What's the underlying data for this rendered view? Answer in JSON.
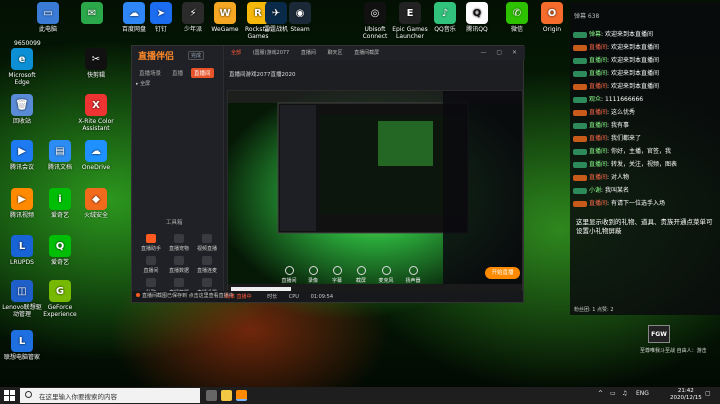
{
  "desktop": {
    "top_icons": [
      {
        "label": "此电脑",
        "color": "#3a7bd5",
        "glyph": "▭"
      },
      {
        "label": "",
        "color": "#2aa84a",
        "glyph": "✉"
      },
      {
        "label": "百度网盘",
        "color": "#2f86f6",
        "glyph": "☁"
      },
      {
        "label": "钉钉",
        "color": "#1c6cf0",
        "glyph": "➤"
      },
      {
        "label": "少年派",
        "color": "#2b2b2b",
        "glyph": "⚡"
      },
      {
        "label": "WeGame",
        "color": "#f5a623",
        "glyph": "W"
      },
      {
        "label": "Rockstar Games",
        "color": "#f6b70b",
        "glyph": "R"
      },
      {
        "label": "雷霆战机",
        "color": "#0a2a4a",
        "glyph": "✈"
      },
      {
        "label": "Steam",
        "color": "#1b2838",
        "glyph": "◉"
      },
      {
        "label": "Ubisoft Connect",
        "color": "#111",
        "glyph": "◎"
      },
      {
        "label": "Epic Games Launcher",
        "color": "#222",
        "glyph": "E"
      },
      {
        "label": "QQ音乐",
        "color": "#31c27c",
        "glyph": "♪"
      },
      {
        "label": "腾讯QQ",
        "color": "#fff",
        "glyph": "Q"
      },
      {
        "label": "微信",
        "color": "#2dc100",
        "glyph": "✆"
      },
      {
        "label": "Origin",
        "color": "#f56c2d",
        "glyph": "O"
      }
    ],
    "side_icons": [
      {
        "label": "Microsoft Edge",
        "color": "#0c8fd4",
        "glyph": "e"
      },
      {
        "label": "快剪辑",
        "color": "#111",
        "glyph": "✂"
      },
      {
        "label": "回收站",
        "color": "#5a8bd6",
        "glyph": "🗑"
      },
      {
        "label": "X-Rite Color Assistant",
        "color": "#e33",
        "glyph": "X"
      },
      {
        "label": "腾讯会议",
        "color": "#1e7af0",
        "glyph": "▶"
      },
      {
        "label": "腾讯文档",
        "color": "#2c8cf4",
        "glyph": "▤"
      },
      {
        "label": "OneDrive",
        "color": "#1e90ff",
        "glyph": "☁"
      },
      {
        "label": "火绒安全",
        "color": "#f26a1b",
        "glyph": "◆"
      },
      {
        "label": "腾讯视频",
        "color": "#ff8a00",
        "glyph": "▶"
      },
      {
        "label": "爱奇艺",
        "color": "#00be06",
        "glyph": "i"
      },
      {
        "label": "LRUPDS",
        "color": "#1863d6",
        "glyph": "L"
      },
      {
        "label": "爱奇艺",
        "color": "#00be06",
        "glyph": "Q"
      },
      {
        "label": "Lenovo联想驱动管理",
        "color": "#1f5fc9",
        "glyph": "◫"
      },
      {
        "label": "GeForce Experience",
        "color": "#76b900",
        "glyph": "G"
      },
      {
        "label": "联想电脑管家",
        "color": "#1e6fe0",
        "glyph": "L"
      }
    ],
    "corner_badge": "9650099"
  },
  "app": {
    "logo": "直播伴侣",
    "version": "完成",
    "left_tabs": [
      "直播场景",
      "直播",
      "直播间"
    ],
    "scene_label": "全屏",
    "tools_title": "工具箱",
    "tools": [
      {
        "label": "直播助手",
        "orange": true
      },
      {
        "label": "直播宠物",
        "orange": false
      },
      {
        "label": "视频直播",
        "orange": false
      },
      {
        "label": "直播间",
        "orange": false
      },
      {
        "label": "直播数据",
        "orange": false
      },
      {
        "label": "直播连麦",
        "orange": false
      },
      {
        "label": "私聊",
        "orange": false
      },
      {
        "label": "直播答题",
        "orange": false
      },
      {
        "label": "直播设置",
        "orange": false
      }
    ],
    "top_tabs": [
      "全部",
      "(国服)游戏2077",
      "直播间",
      "聊天区",
      "直播间截屏"
    ],
    "stream_title": "直播间游戏2077直播2020",
    "bottom_left": "直播间截图已保存到 点击这里查看直播中",
    "controls": [
      "直播间",
      "录像",
      "字幕",
      "截屏",
      "麦克风",
      "扬声器"
    ],
    "live_button": "开始直播",
    "status_items": [
      "码率 直播中",
      "时长",
      "CPU",
      "01:09:54"
    ]
  },
  "chat": {
    "header": "弹幕 638",
    "rows": [
      {
        "user": "弹幕",
        "msg": "欢迎来到本直播间",
        "tag": "green"
      },
      {
        "user": "直播间",
        "msg": "欢迎来到本直播间",
        "tag": "orange"
      },
      {
        "user": "直播间",
        "msg": "欢迎来到本直播间",
        "tag": "green"
      },
      {
        "user": "直播间",
        "msg": "欢迎来到本直播间",
        "tag": "green"
      },
      {
        "user": "直播间",
        "msg": "欢迎来到本直播间",
        "tag": "orange"
      },
      {
        "user": "观众",
        "msg": "1111666666",
        "tag": "green"
      },
      {
        "user": "直播间",
        "msg": "这么优秀",
        "tag": "orange"
      },
      {
        "user": "直播间",
        "msg": "我有事",
        "tag": "green"
      },
      {
        "user": "直播间",
        "msg": "我们都来了",
        "tag": "orange"
      },
      {
        "user": "直播间",
        "msg": "你好，主播，官签，我",
        "tag": "green"
      },
      {
        "user": "直播间",
        "msg": "转发，关注，视频，图表",
        "tag": "green"
      },
      {
        "user": "直播间",
        "msg": "对人物",
        "tag": "orange"
      },
      {
        "user": "小谢",
        "msg": "我叫某名",
        "tag": "green"
      },
      {
        "user": "直播间",
        "msg": "有请下一位选手入场",
        "tag": "orange"
      }
    ],
    "note": "这里显示收到的礼物、道具、贵族开通点菜单可设置小礼物屏蔽",
    "bottom_text": "粉丝团: 1  点赞: 2",
    "fgw": "FGW",
    "fgw_label": "至尊唯我斗至战 自由人：游击"
  },
  "taskbar": {
    "search_placeholder": "在这里输入你要搜索的内容",
    "time": "21:42",
    "date": "2020/12/15",
    "lang": "ENG"
  }
}
